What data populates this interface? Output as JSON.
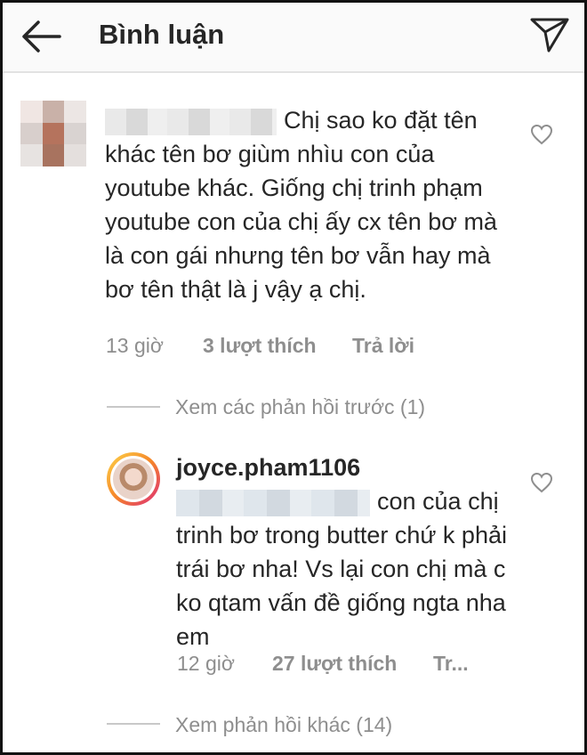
{
  "header": {
    "title": "Bình luận",
    "back_icon": "arrow-left-icon",
    "send_icon": "paper-plane-icon"
  },
  "comment": {
    "text": "Chị sao ko đặt tên khác tên bơ giùm nhìu con của youtube khác. Giống chị trinh phạm youtube con của chị ấy cx tên bơ mà là con gái nhưng tên bơ vẫn hay mà bơ tên thật là j vậy ạ chị.",
    "time": "13 giờ",
    "likes": "3 lượt thích",
    "reply_label": "Trả lời"
  },
  "view_previous_replies": "Xem các phản hồi trước (1)",
  "reply": {
    "username": "joyce.pham1106",
    "text": "con của chị trinh bơ trong butter chứ k phải trái bơ nha! Vs lại con chị mà c ko qtam vấn đề giống ngta nha em",
    "time": "12 giờ",
    "likes": "27 lượt thích",
    "reply_label": "Tr..."
  },
  "view_more_replies": "Xem phản hồi khác (14)",
  "colors": {
    "text_primary": "#262626",
    "text_secondary": "#8e8e8e",
    "header_bg": "#fafafa"
  }
}
